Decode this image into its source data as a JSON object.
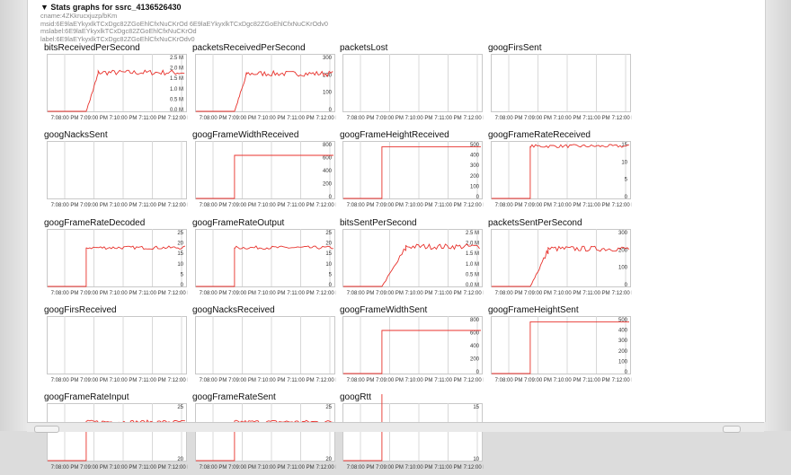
{
  "header": {
    "title": "▼ Stats graphs for ssrc_4136526430",
    "lines": [
      "cname:4ZKkrucxjuzp/bKm",
      "msid:6E9laEYkyxlkTCxDgc82ZGoEhlCfxNuCKrOd 6E9laEYkyxlkTCxDgc82ZGoEhlCfxNuCKrOdv0",
      "mslabel:6E9laEYkyxlkTCxDgc82ZGoEhlCfxNuCKrOd",
      "label:6E9laEYkyxlkTCxDgc82ZGoEhlCfxNuCKrOdv0"
    ]
  },
  "x_ticks": [
    "7:08:00 PM",
    "7:09:00 PM",
    "7:10:00 PM",
    "7:11:00 PM",
    "7:12:00 PM"
  ],
  "colors": {
    "line": "#e8322c",
    "grid": "#d8d8d8",
    "axis": "#9a9a9a"
  },
  "chart_data": [
    {
      "type": "line",
      "title": "bitsReceivedPerSecond",
      "yticks": [
        "2.5 M",
        "2.0 M",
        "1.5 M",
        "1.0 M",
        "0.5 M",
        "0.0 M"
      ],
      "ylim": [
        0,
        2.5
      ],
      "shape": "ramp",
      "level": 1.8,
      "start": 0.33,
      "ramp": 0.1
    },
    {
      "type": "line",
      "title": "packetsReceivedPerSecond",
      "yticks": [
        "300",
        "200",
        "100",
        "0"
      ],
      "ylim": [
        0,
        300
      ],
      "shape": "ramp",
      "level": 210,
      "start": 0.33,
      "ramp": 0.1
    },
    {
      "type": "line",
      "title": "packetsLost",
      "yticks": [],
      "ylim": [
        0,
        1
      ],
      "shape": "none"
    },
    {
      "type": "line",
      "title": "googFirsSent",
      "yticks": [],
      "ylim": [
        0,
        1
      ],
      "shape": "none"
    },
    {
      "type": "line",
      "title": "googNacksSent",
      "yticks": [],
      "ylim": [
        0,
        1
      ],
      "shape": "none"
    },
    {
      "type": "line",
      "title": "googFrameWidthReceived",
      "yticks": [
        "800",
        "600",
        "400",
        "200",
        "0"
      ],
      "ylim": [
        0,
        800
      ],
      "shape": "step",
      "level": 640,
      "start": 0.33
    },
    {
      "type": "line",
      "title": "googFrameHeightReceived",
      "yticks": [
        "500",
        "400",
        "300",
        "200",
        "100",
        "0"
      ],
      "ylim": [
        0,
        500
      ],
      "shape": "step",
      "level": 480,
      "start": 0.33
    },
    {
      "type": "line",
      "title": "googFrameRateReceived",
      "yticks": [
        "15",
        "10",
        "5",
        "0"
      ],
      "ylim": [
        0,
        17
      ],
      "shape": "noisystep",
      "level": 16.5,
      "start": 0.33
    },
    {
      "type": "line",
      "title": "googFrameRateDecoded",
      "yticks": [
        "25",
        "20",
        "15",
        "10",
        "5",
        "0"
      ],
      "ylim": [
        0,
        25
      ],
      "shape": "noisystep",
      "level": 18,
      "start": 0.33
    },
    {
      "type": "line",
      "title": "googFrameRateOutput",
      "yticks": [
        "25",
        "20",
        "15",
        "10",
        "5",
        "0"
      ],
      "ylim": [
        0,
        25
      ],
      "shape": "noisystep",
      "level": 18,
      "start": 0.33
    },
    {
      "type": "line",
      "title": "bitsSentPerSecond",
      "yticks": [
        "2.5 M",
        "2.0 M",
        "1.5 M",
        "1.0 M",
        "0.5 M",
        "0.0 M"
      ],
      "ylim": [
        0,
        2.5
      ],
      "shape": "ramp",
      "level": 1.85,
      "start": 0.33,
      "ramp": 0.2
    },
    {
      "type": "line",
      "title": "packetsSentPerSecond",
      "yticks": [
        "300",
        "200",
        "100",
        "0"
      ],
      "ylim": [
        0,
        300
      ],
      "shape": "ramp",
      "level": 210,
      "start": 0.33,
      "ramp": 0.15
    },
    {
      "type": "line",
      "title": "googFirsReceived",
      "yticks": [],
      "ylim": [
        0,
        1
      ],
      "shape": "none"
    },
    {
      "type": "line",
      "title": "googNacksReceived",
      "yticks": [],
      "ylim": [
        0,
        1
      ],
      "shape": "none"
    },
    {
      "type": "line",
      "title": "googFrameWidthSent",
      "yticks": [
        "800",
        "600",
        "400",
        "200",
        "0"
      ],
      "ylim": [
        0,
        800
      ],
      "shape": "step",
      "level": 640,
      "start": 0.33
    },
    {
      "type": "line",
      "title": "googFrameHeightSent",
      "yticks": [
        "500",
        "400",
        "300",
        "200",
        "100",
        "0"
      ],
      "ylim": [
        0,
        500
      ],
      "shape": "step",
      "level": 480,
      "start": 0.33
    },
    {
      "type": "line",
      "title": "googFrameRateInput",
      "yticks": [
        "25",
        "20"
      ],
      "ylim": [
        0,
        25
      ],
      "shape": "noisystep",
      "level": 18,
      "start": 0.33,
      "partial": true
    },
    {
      "type": "line",
      "title": "googFrameRateSent",
      "yticks": [
        "25",
        "20"
      ],
      "ylim": [
        0,
        25
      ],
      "shape": "noisystep",
      "level": 18,
      "start": 0.33,
      "partial": true
    },
    {
      "type": "line",
      "title": "googRtt",
      "yticks": [
        "15",
        "10"
      ],
      "ylim": [
        0,
        15
      ],
      "shape": "spike",
      "level": 15,
      "start": 0.33,
      "partial": true
    }
  ]
}
